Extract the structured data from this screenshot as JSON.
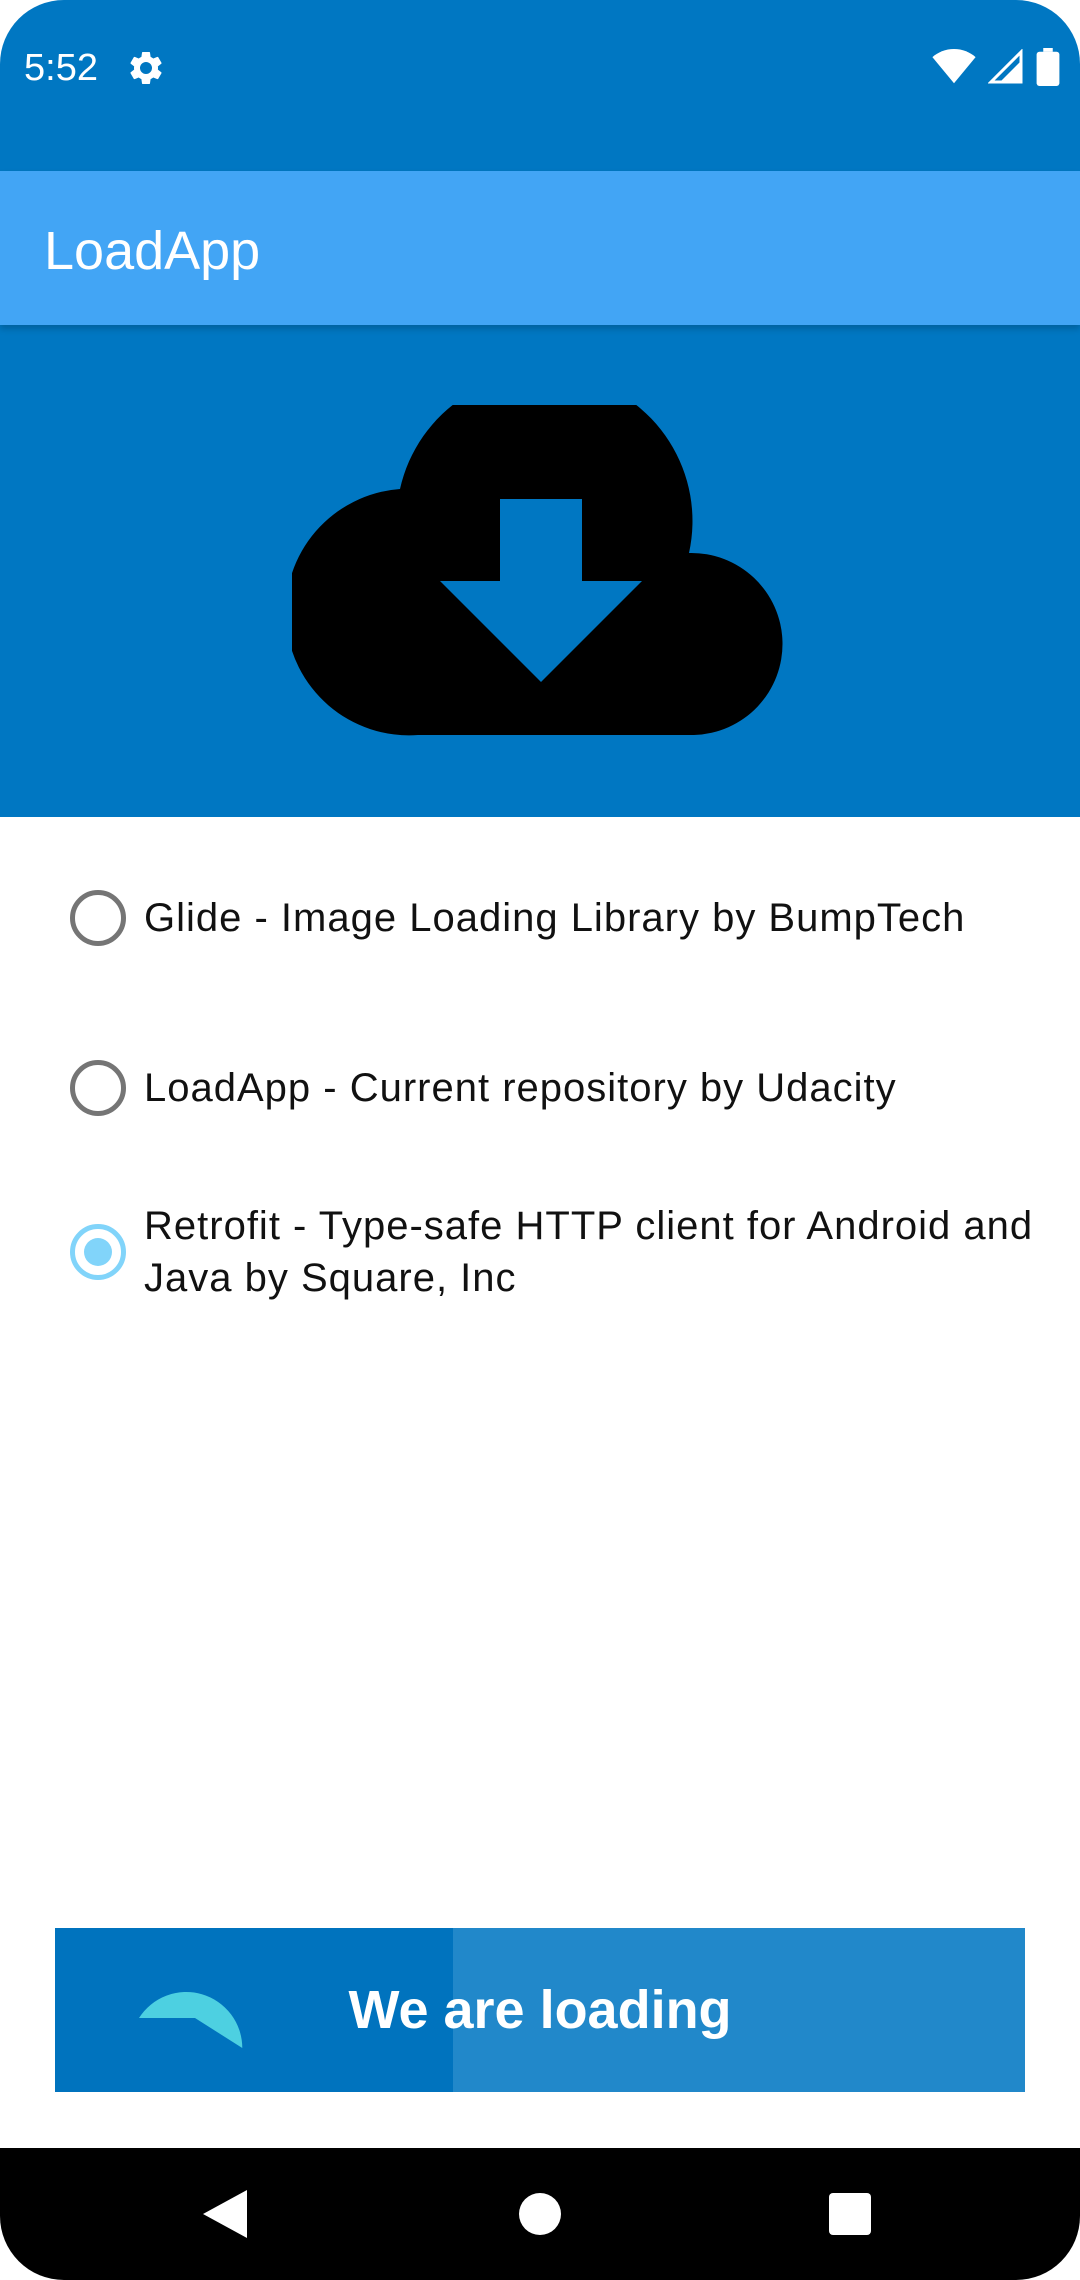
{
  "status_bar": {
    "time": "5:52",
    "icons": [
      "gear-icon",
      "wifi-icon",
      "cellular-signal-icon",
      "battery-icon"
    ]
  },
  "app_bar": {
    "title": "LoadApp"
  },
  "hero": {
    "icon": "cloud-download-icon"
  },
  "options": [
    {
      "label": "Glide - Image Loading Library by BumpTech",
      "selected": false
    },
    {
      "label": "LoadApp - Current repository by Udacity",
      "selected": false
    },
    {
      "label": "Retrofit - Type-safe HTTP client for Android and Java by Square, Inc",
      "selected": true
    }
  ],
  "load_button": {
    "label": "We are loading",
    "progress": 0.41
  },
  "nav_bar": {
    "icons": [
      "back-icon",
      "home-icon",
      "recents-icon"
    ]
  },
  "colors": {
    "primary_dark": "#0077c2",
    "primary": "#42a5f5",
    "accent": "#81d4fa",
    "button_bg": "#2188ca",
    "button_progress": "#0073be",
    "circle": "#4dd0e1"
  }
}
